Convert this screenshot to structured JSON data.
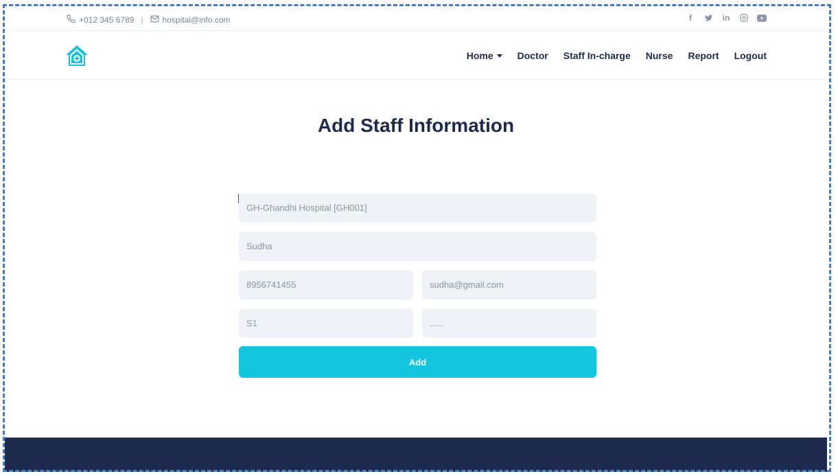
{
  "topbar": {
    "phone": "+012 345 6789",
    "separator": "|",
    "email": "hospital@info.com",
    "social": [
      {
        "icon": "facebook-icon",
        "glyph": "f"
      },
      {
        "icon": "twitter-icon",
        "glyph": "🐦"
      },
      {
        "icon": "linkedin-icon",
        "glyph": "in"
      },
      {
        "icon": "instagram-icon",
        "glyph": "◎"
      },
      {
        "icon": "youtube-icon",
        "glyph": "▶"
      }
    ]
  },
  "navbar": {
    "logo_icon": "hospital-house-icon",
    "items": {
      "home": "Home",
      "doctor": "Doctor",
      "staff": "Staff In-charge",
      "nurse": "Nurse",
      "report": "Report",
      "logout": "Logout"
    }
  },
  "form": {
    "title": "Add Staff Information",
    "hospital": "GH-Ghandhi Hospital [GH001]",
    "name": "Sudha",
    "phone": "8956741455",
    "email": "sudha@gmail.com",
    "staff_id": "S1",
    "password": "......",
    "submit_label": "Add"
  },
  "colors": {
    "accent": "#13c5dd",
    "navy": "#1d2a4d",
    "field_bg": "#eff3f8"
  }
}
